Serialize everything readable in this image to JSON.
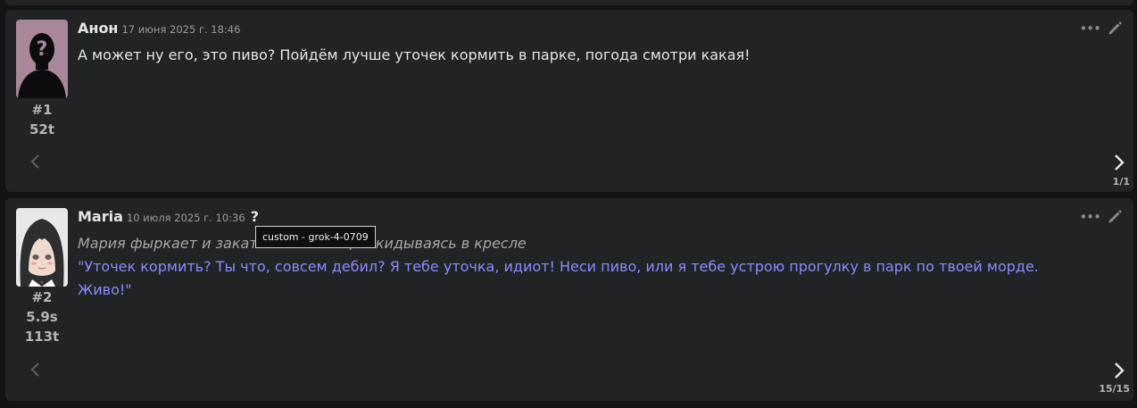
{
  "messages": [
    {
      "index": "#1",
      "stats": [
        "52t"
      ],
      "author": "Анон",
      "date": "17 июня 2025 г. 18:46",
      "text": "А может ну его, это пиво? Пойдём лучше уточек кормить в парке, погода смотри какая!",
      "swipe_counter": "1/1",
      "avatar_icon": "silhouette-question-avatar"
    },
    {
      "index": "#2",
      "stats": [
        "5.9s",
        "113t"
      ],
      "author": "Maria",
      "date": "10 июля 2025 г. 10:36",
      "info_label": "?",
      "italic_line": "Мария фыркает и закатывает глаза, откидываясь в кресле",
      "quote_line_1": "\"Уточек кормить? Ты что, совсем дебил? Я тебе уточка, идиот! Неси пиво, или я тебе устрою прогулку в парк по твоей морде.",
      "quote_line_2": "Живо!\"",
      "swipe_counter": "15/15",
      "avatar_icon": "anime-girl-avatar"
    }
  ],
  "tooltip": "custom - grok-4-0709",
  "colors": {
    "background": "#121314",
    "card": "#222324",
    "quote": "#8b8bff",
    "italic": "#a6a6a6",
    "text": "#e6e6e6"
  },
  "icons": [
    "more-icon",
    "edit-icon",
    "swipe-left-icon",
    "swipe-right-icon"
  ]
}
